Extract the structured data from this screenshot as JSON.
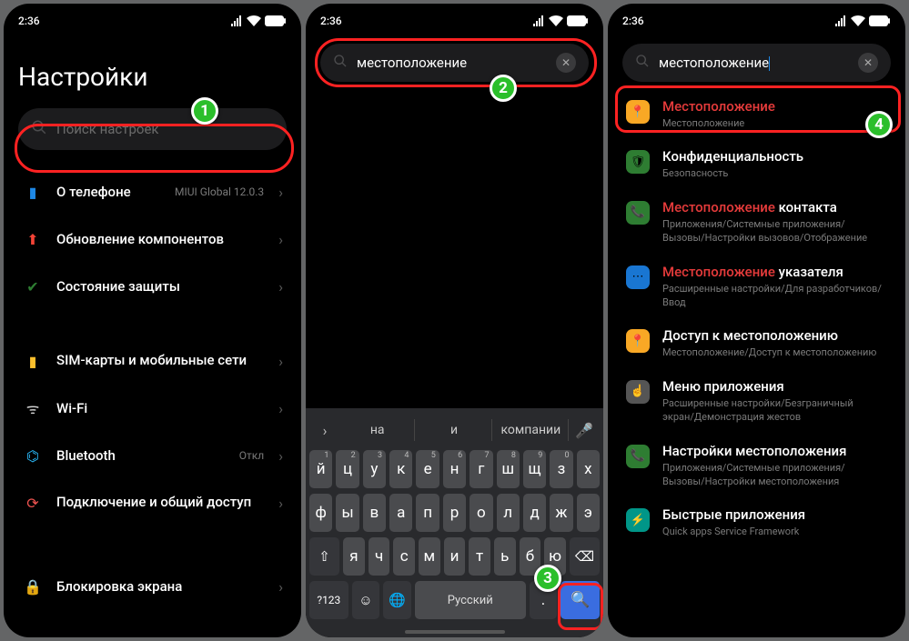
{
  "status": {
    "time": "2:36"
  },
  "colors": {
    "highlight": "#ff2222",
    "badge_bg": "#2bbf2b",
    "search_key": "#3a6de0",
    "result_hl": "#e63b3b"
  },
  "badges": [
    "1",
    "2",
    "3",
    "4"
  ],
  "phone1": {
    "title": "Настройки",
    "search_placeholder": "Поиск настроек",
    "items": [
      {
        "icon": "about-icon",
        "color": "#1e88e5",
        "glyph": "▮",
        "label": "О телефоне",
        "value": "MIUI Global 12.0.3"
      },
      {
        "icon": "update-icon",
        "color": "#f44336",
        "glyph": "⬆",
        "label": "Обновление компонентов"
      },
      {
        "icon": "shield-icon",
        "color": "#2e7d32",
        "glyph": "✔",
        "label": "Состояние защиты"
      },
      {
        "gap": true
      },
      {
        "icon": "sim-icon",
        "color": "#fbc02d",
        "glyph": "▮",
        "label": "SIM-карты и мобильные сети",
        "two": true
      },
      {
        "icon": "wifi-icon",
        "color": "#d6d6d6",
        "glyph": "ᯤ",
        "label": "Wi-Fi",
        "value": " "
      },
      {
        "icon": "bluetooth-icon",
        "color": "#29b6f6",
        "glyph": "⌬",
        "label": "Bluetooth",
        "value": "Откл"
      },
      {
        "icon": "share-icon",
        "color": "#ef5350",
        "glyph": "⟳",
        "label": "Подключение и общий доступ",
        "two": true
      },
      {
        "gap": "tall"
      },
      {
        "icon": "lock-icon",
        "color": "#d32f2f",
        "glyph": "🔒",
        "label": "Блокировка экрана"
      }
    ]
  },
  "phone2": {
    "search_value": "местоположение",
    "suggestions": [
      "на",
      "и",
      "компании"
    ],
    "row1": {
      "keys": [
        "й",
        "ц",
        "у",
        "к",
        "е",
        "н",
        "г",
        "ш",
        "щ",
        "з",
        "х"
      ],
      "sup": [
        "1",
        "2",
        "3",
        "4",
        "5",
        "6",
        "7",
        "8",
        "9",
        "0",
        ""
      ]
    },
    "row2": {
      "keys": [
        "ф",
        "ы",
        "в",
        "а",
        "п",
        "р",
        "о",
        "л",
        "д",
        "ж",
        "э"
      ]
    },
    "row3": {
      "keys": [
        "я",
        "ч",
        "с",
        "м",
        "и",
        "т",
        "ь",
        "б",
        "ю"
      ]
    },
    "row4": {
      "numkey": "?123",
      "comma": ",",
      "space": "Русский",
      "period": "."
    }
  },
  "phone3": {
    "search_value": "местоположение",
    "results": [
      {
        "icon_bg": "#f9a825",
        "glyph": "📍",
        "title_hl": "Местоположение",
        "title_rest": "",
        "sub": "Местоположение"
      },
      {
        "icon_bg": "#2e7d32",
        "glyph": "🛡",
        "title_hl": "",
        "title_rest": "Конфиденциальность",
        "sub": "Безопасность"
      },
      {
        "icon_bg": "#2e7d32",
        "glyph": "📞",
        "title_hl": "Местоположение",
        "title_rest": " контакта",
        "sub": "Приложения/Системные приложения/Вызовы/Настройки вызовов/Отображение"
      },
      {
        "icon_bg": "#1976d2",
        "glyph": "⋯",
        "title_hl": "Местоположение",
        "title_rest": " указателя",
        "sub": "Расширенные настройки/Для разработчиков/Ввод"
      },
      {
        "icon_bg": "#f9a825",
        "glyph": "📍",
        "title_hl": "",
        "title_rest": "Доступ к местоположению",
        "sub": "Местоположение/Доступ к местоположению"
      },
      {
        "icon_bg": "#555",
        "glyph": "☝",
        "title_hl": "",
        "title_rest": "Меню приложения",
        "sub": "Расширенные настройки/Безграничный экран/Демонстрация жестов"
      },
      {
        "icon_bg": "#2e7d32",
        "glyph": "📞",
        "title_hl": "",
        "title_rest": "Настройки местоположения",
        "sub": "Приложения/Системные приложения/Вызовы/Настройки местоположения"
      },
      {
        "icon_bg": "#009688",
        "glyph": "⚡",
        "title_hl": "",
        "title_rest": "Быстрые приложения",
        "sub": "Quick apps Service Framework"
      }
    ]
  }
}
